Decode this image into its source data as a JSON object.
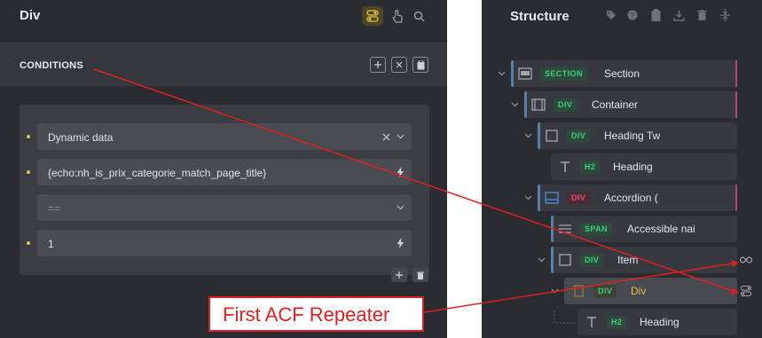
{
  "left_panel": {
    "title": "Div",
    "conditions": {
      "title": "CONDITIONS",
      "rows": [
        {
          "text": "Dynamic data"
        },
        {
          "text": "{echo:nh_is_prix_categorie_match_page_title}"
        },
        {
          "text": "=="
        },
        {
          "text": "1"
        }
      ]
    }
  },
  "structure": {
    "title": "Structure",
    "nodes": [
      {
        "badge": "SECTION",
        "label": "Section"
      },
      {
        "badge": "DIV",
        "label": "Container"
      },
      {
        "badge": "DIV",
        "label": "Heading Tw"
      },
      {
        "badge": "H2",
        "label": "Heading"
      },
      {
        "badge": "DIV",
        "label": "Accordion ("
      },
      {
        "badge": "SPAN",
        "label": "Accessible nai"
      },
      {
        "badge": "DIV",
        "label": "Item"
      },
      {
        "badge": "DIV",
        "label": "Div"
      },
      {
        "badge": "H2",
        "label": "Heading"
      }
    ]
  },
  "annotation": {
    "text": "First ACF Repeater",
    "color": "#e02020"
  },
  "colors": {
    "accent_gold": "#e2c44a",
    "badge_green": "#3bd07e",
    "badge_red": "#e2506c",
    "panel_bg": "#2a2c31"
  }
}
